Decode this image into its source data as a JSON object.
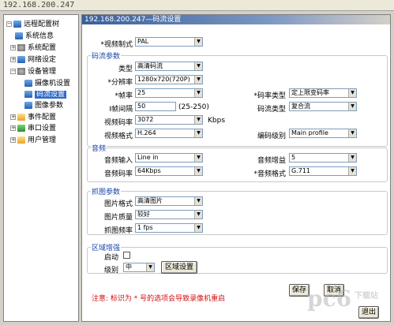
{
  "window": {
    "title": "192.168.200.247"
  },
  "tree": {
    "root": "远程配置树",
    "items": [
      {
        "label": "系统信息",
        "expandable": false
      },
      {
        "label": "系统配置",
        "expandable": true
      },
      {
        "label": "网络设定",
        "expandable": true
      },
      {
        "label": "设备管理",
        "expandable": true,
        "expanded": true
      },
      {
        "label": "摄像机设置",
        "child": true
      },
      {
        "label": "码流设置",
        "child": true,
        "selected": true
      },
      {
        "label": "图像参数",
        "child": true
      },
      {
        "label": "事件配置",
        "expandable": true
      },
      {
        "label": "串口设置",
        "expandable": true
      },
      {
        "label": "用户管理",
        "expandable": true
      }
    ]
  },
  "panel": {
    "header": "192.168.200.247—码流设置",
    "video_standard": {
      "label": "*视频制式",
      "value": "PAL"
    },
    "stream": {
      "title": "码流参数",
      "type": {
        "label": "类型",
        "value": "高清码流"
      },
      "resolution": {
        "label": "*分辨率",
        "value": "1280x720(720P)"
      },
      "fps": {
        "label": "*帧率",
        "value": "25"
      },
      "bitrate_type": {
        "label": "*码率类型",
        "value": "定上限变码率"
      },
      "iframe_interval": {
        "label": "I帧间隔",
        "value": "50",
        "range": "(25-250)"
      },
      "stream_type": {
        "label": "码流类型",
        "value": "复合流"
      },
      "video_bitrate": {
        "label": "视频码率",
        "value": "3072",
        "unit": "Kbps"
      },
      "video_format": {
        "label": "视频格式",
        "value": "H.264"
      },
      "encode_level": {
        "label": "编码级别",
        "value": "Main profile"
      }
    },
    "audio": {
      "title": "音频",
      "input": {
        "label": "音频输入",
        "value": "Line in"
      },
      "gain": {
        "label": "音频增益",
        "value": "5"
      },
      "bitrate": {
        "label": "音频码率",
        "value": "64Kbps"
      },
      "format": {
        "label": "*音频格式",
        "value": "G.711"
      }
    },
    "snapshot": {
      "title": "抓图参数",
      "format": {
        "label": "图片格式",
        "value": "高清图片"
      },
      "quality": {
        "label": "图片质量",
        "value": "较好"
      },
      "rate": {
        "label": "抓图频率",
        "value": "1 fps"
      }
    },
    "roi": {
      "title": "区域增强",
      "enable_label": "启动",
      "enabled": false,
      "level": {
        "label": "级别",
        "value": "中"
      },
      "button": "区域设置"
    },
    "note": "注意: 标识为 * 号的选项会导致录像机重启",
    "buttons": {
      "save": "保存",
      "cancel": "取消",
      "exit": "退出"
    }
  },
  "watermark": {
    "brand": "pc6",
    "sub": "下载站"
  }
}
